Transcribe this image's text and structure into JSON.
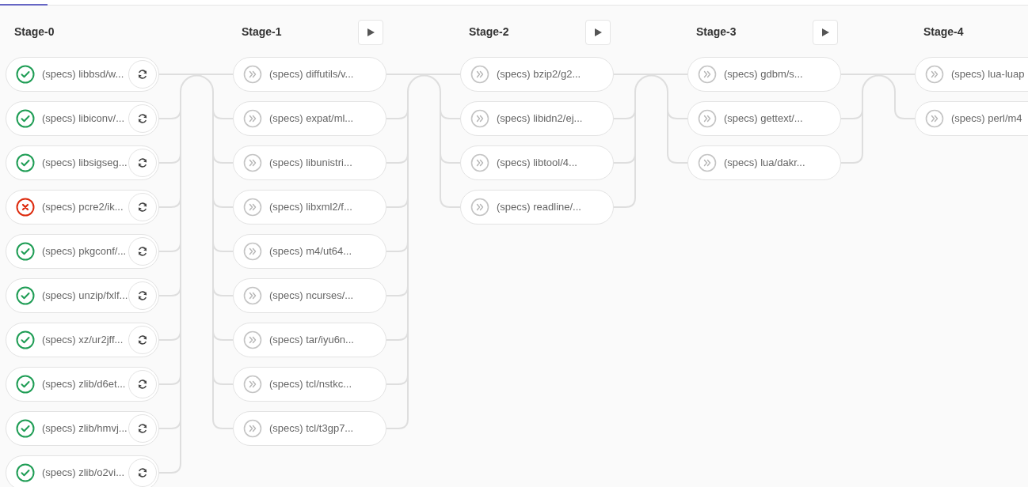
{
  "stages": [
    {
      "title": "Stage-0",
      "play_button": false,
      "jobs": [
        {
          "name": "(specs) libbsd/w...",
          "kind": "success",
          "retry": true
        },
        {
          "name": "(specs) libiconv/...",
          "kind": "success",
          "retry": true
        },
        {
          "name": "(specs) libsigseg...",
          "kind": "success",
          "retry": true
        },
        {
          "name": "(specs) pcre2/ik...",
          "kind": "failed",
          "retry": true
        },
        {
          "name": "(specs) pkgconf/...",
          "kind": "success",
          "retry": true
        },
        {
          "name": "(specs) unzip/fxlf...",
          "kind": "success",
          "retry": true
        },
        {
          "name": "(specs) xz/ur2jff...",
          "kind": "success",
          "retry": true
        },
        {
          "name": "(specs) zlib/d6et...",
          "kind": "success",
          "retry": true
        },
        {
          "name": "(specs) zlib/hmvj...",
          "kind": "success",
          "retry": true
        },
        {
          "name": "(specs) zlib/o2vi...",
          "kind": "success",
          "retry": true
        }
      ]
    },
    {
      "title": "Stage-1",
      "play_button": true,
      "jobs": [
        {
          "name": "(specs) diffutils/v...",
          "kind": "skipped",
          "retry": false
        },
        {
          "name": "(specs) expat/ml...",
          "kind": "skipped",
          "retry": false
        },
        {
          "name": "(specs) libunistri...",
          "kind": "skipped",
          "retry": false
        },
        {
          "name": "(specs) libxml2/f...",
          "kind": "skipped",
          "retry": false
        },
        {
          "name": "(specs) m4/ut64...",
          "kind": "skipped",
          "retry": false
        },
        {
          "name": "(specs) ncurses/...",
          "kind": "skipped",
          "retry": false
        },
        {
          "name": "(specs) tar/iyu6n...",
          "kind": "skipped",
          "retry": false
        },
        {
          "name": "(specs) tcl/nstkc...",
          "kind": "skipped",
          "retry": false
        },
        {
          "name": "(specs) tcl/t3gp7...",
          "kind": "skipped",
          "retry": false
        }
      ]
    },
    {
      "title": "Stage-2",
      "play_button": true,
      "jobs": [
        {
          "name": "(specs) bzip2/g2...",
          "kind": "skipped",
          "retry": false
        },
        {
          "name": "(specs) libidn2/ej...",
          "kind": "skipped",
          "retry": false
        },
        {
          "name": "(specs) libtool/4...",
          "kind": "skipped",
          "retry": false
        },
        {
          "name": "(specs) readline/...",
          "kind": "skipped",
          "retry": false
        }
      ]
    },
    {
      "title": "Stage-3",
      "play_button": true,
      "jobs": [
        {
          "name": "(specs) gdbm/s...",
          "kind": "skipped",
          "retry": false
        },
        {
          "name": "(specs) gettext/...",
          "kind": "skipped",
          "retry": false
        },
        {
          "name": "(specs) lua/dakr...",
          "kind": "skipped",
          "retry": false
        }
      ]
    },
    {
      "title": "Stage-4",
      "play_button": false,
      "jobs": [
        {
          "name": "(specs) lua-luap",
          "kind": "skipped",
          "retry": false
        },
        {
          "name": "(specs) perl/m4",
          "kind": "skipped",
          "retry": false
        }
      ]
    }
  ]
}
